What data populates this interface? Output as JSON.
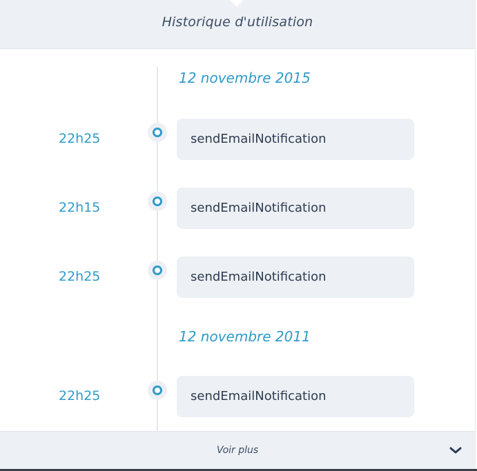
{
  "header": {
    "title": "Historique d'utilisation"
  },
  "timeline": {
    "groups": [
      {
        "date": "12 novembre 2015",
        "entries": [
          {
            "time": "22h25",
            "event": "sendEmailNotification"
          },
          {
            "time": "22h15",
            "event": "sendEmailNotification"
          },
          {
            "time": "22h25",
            "event": "sendEmailNotification"
          }
        ]
      },
      {
        "date": "12 novembre 2011",
        "entries": [
          {
            "time": "22h25",
            "event": "sendEmailNotification"
          }
        ]
      }
    ]
  },
  "footer": {
    "label": "Voir plus",
    "icon": "chevron-down-icon"
  },
  "colors": {
    "accent": "#2e9bc9",
    "panel": "#edf0f4",
    "text": "#2e3b50"
  }
}
